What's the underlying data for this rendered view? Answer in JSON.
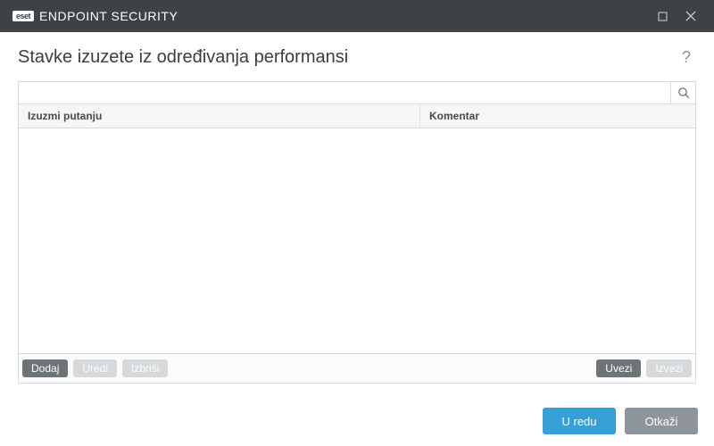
{
  "brand": {
    "logo": "eset",
    "name": "ENDPOINT SECURITY"
  },
  "page": {
    "title": "Stavke izuzete iz određivanja performansi"
  },
  "search": {
    "value": "",
    "placeholder": ""
  },
  "table": {
    "columns": {
      "path": "Izuzmi putanju",
      "comment": "Komentar"
    },
    "rows": []
  },
  "actions": {
    "add": "Dodaj",
    "edit": "Uredi",
    "delete": "Izbriši",
    "import": "Uvezi",
    "export": "Izvezi"
  },
  "footer": {
    "ok": "U redu",
    "cancel": "Otkaži"
  }
}
